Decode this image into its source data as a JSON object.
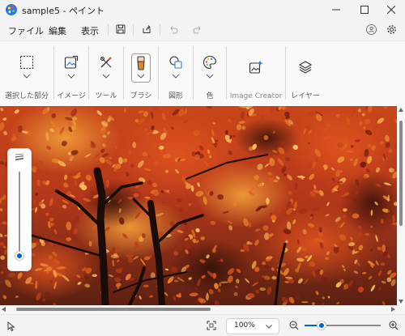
{
  "window": {
    "title": "sample5 - ペイント",
    "minimize_icon": "minimize-icon",
    "maximize_icon": "maximize-icon",
    "close_icon": "close-icon"
  },
  "menu": {
    "items": [
      {
        "label": "ファイル"
      },
      {
        "label": "編集"
      },
      {
        "label": "表示"
      }
    ],
    "icons": [
      "save-icon",
      "share-icon",
      "undo-icon",
      "redo-icon",
      "account-icon",
      "settings-icon"
    ]
  },
  "ribbon": {
    "groups": [
      {
        "label": "選択した部分",
        "icon": "selection-icon"
      },
      {
        "label": "イメージ",
        "icon": "image-icon"
      },
      {
        "label": "ツール",
        "icon": "tools-icon"
      },
      {
        "label": "ブラシ",
        "icon": "brush-icon",
        "selected": true
      },
      {
        "label": "図形",
        "icon": "shapes-icon"
      },
      {
        "label": "色",
        "icon": "palette-icon"
      },
      {
        "label": "Image Creator",
        "icon": "image-creator-icon",
        "disabled": true
      },
      {
        "label": "レイヤー",
        "icon": "layers-icon"
      }
    ]
  },
  "canvas": {
    "image": "autumn-foliage-photo",
    "colors": {
      "base": "#b83a14",
      "bright": "#e8822a",
      "dark": "#3a1208",
      "trunk": "#1a0c08"
    }
  },
  "brush_size": {
    "level": 0.0,
    "accent": "#0067c0"
  },
  "status": {
    "zoom": "100%",
    "zoom_slider_level": 0.22,
    "icons": [
      "pointer-icon",
      "fit-to-window-icon",
      "zoom-out-icon",
      "zoom-in-icon",
      "chevron-down-icon"
    ]
  },
  "accent_color": "#0067c0"
}
